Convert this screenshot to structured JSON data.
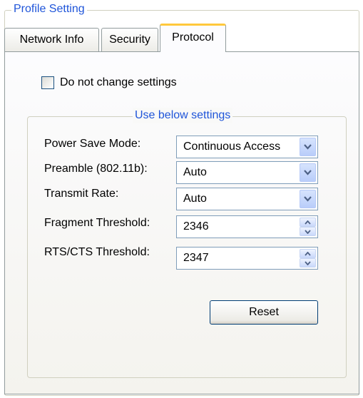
{
  "profile": {
    "legend": "Profile Setting"
  },
  "tabs": [
    {
      "label": "Network Info"
    },
    {
      "label": "Security"
    },
    {
      "label": "Protocol",
      "active": true
    }
  ],
  "protocol": {
    "do_not_change": {
      "label": "Do not change settings",
      "checked": false
    },
    "group_label": "Use below settings",
    "fields": [
      {
        "label": "Power Save Mode:",
        "value": "Continuous Access",
        "control": "dropdown"
      },
      {
        "label": "Preamble (802.11b):",
        "value": "Auto",
        "control": "dropdown"
      },
      {
        "label": "Transmit Rate:",
        "value": "Auto",
        "control": "dropdown"
      },
      {
        "label": "Fragment Threshold:",
        "value": "2346",
        "control": "spinner"
      },
      {
        "label": "RTS/CTS Threshold:",
        "value": "2347",
        "control": "spinner"
      }
    ],
    "reset_label": "Reset"
  },
  "colors": {
    "group_label": "#1f55d9",
    "active_tab_accent": "#ffc83c",
    "input_border": "#7f9db9",
    "arrow_button": "#c6d6fb"
  },
  "icons": [
    "chevron-down-icon",
    "spin-up-icon",
    "spin-down-icon"
  ]
}
